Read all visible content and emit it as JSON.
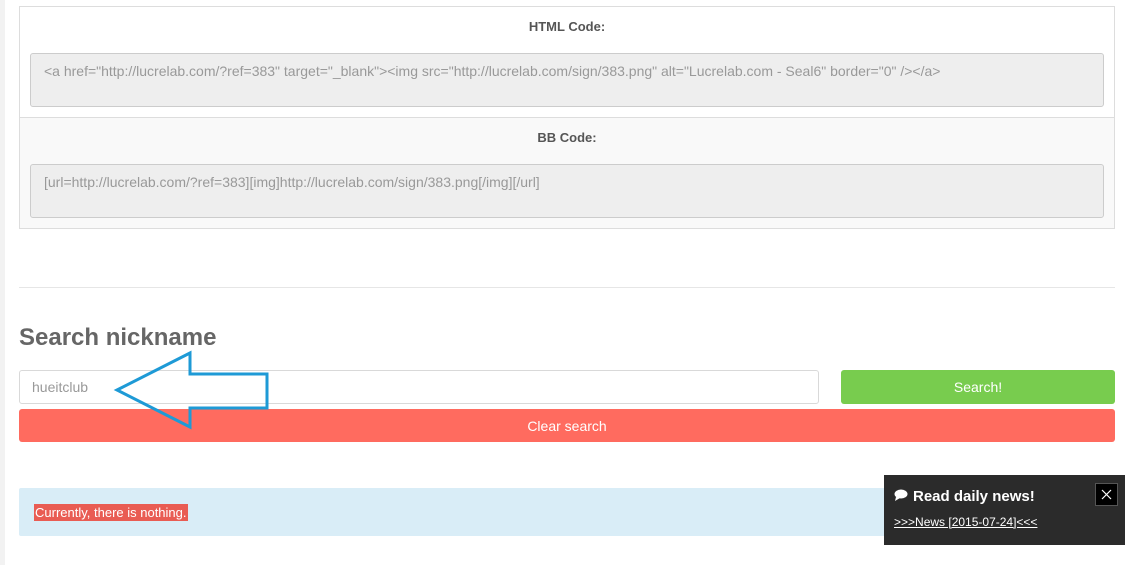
{
  "code_section": {
    "html_label": "HTML Code:",
    "html_value": "<a href=\"http://lucrelab.com/?ref=383\" target=\"_blank\"><img src=\"http://lucrelab.com/sign/383.png\" alt=\"Lucrelab.com - Seal6\" border=\"0\" /></a>",
    "bb_label": "BB Code:",
    "bb_value": "[url=http://lucrelab.com/?ref=383][img]http://lucrelab.com/sign/383.png[/img][/url]"
  },
  "search": {
    "title": "Search nickname",
    "input_value": "hueitclub",
    "search_button": "Search!",
    "clear_button": "Clear search"
  },
  "info": {
    "message": "Currently, there is nothing."
  },
  "news": {
    "title": "Read daily news!",
    "link": ">>>News [2015-07-24]<<<",
    "icon": "comment-icon",
    "close_icon": "close-icon"
  },
  "colors": {
    "search_button": "#78cc4e",
    "clear_button": "#ff6b5f",
    "info_background": "#d9edf7",
    "highlight": "#e95c53",
    "arrow": "#1e9ad6",
    "news_background": "#2b2b2b"
  }
}
